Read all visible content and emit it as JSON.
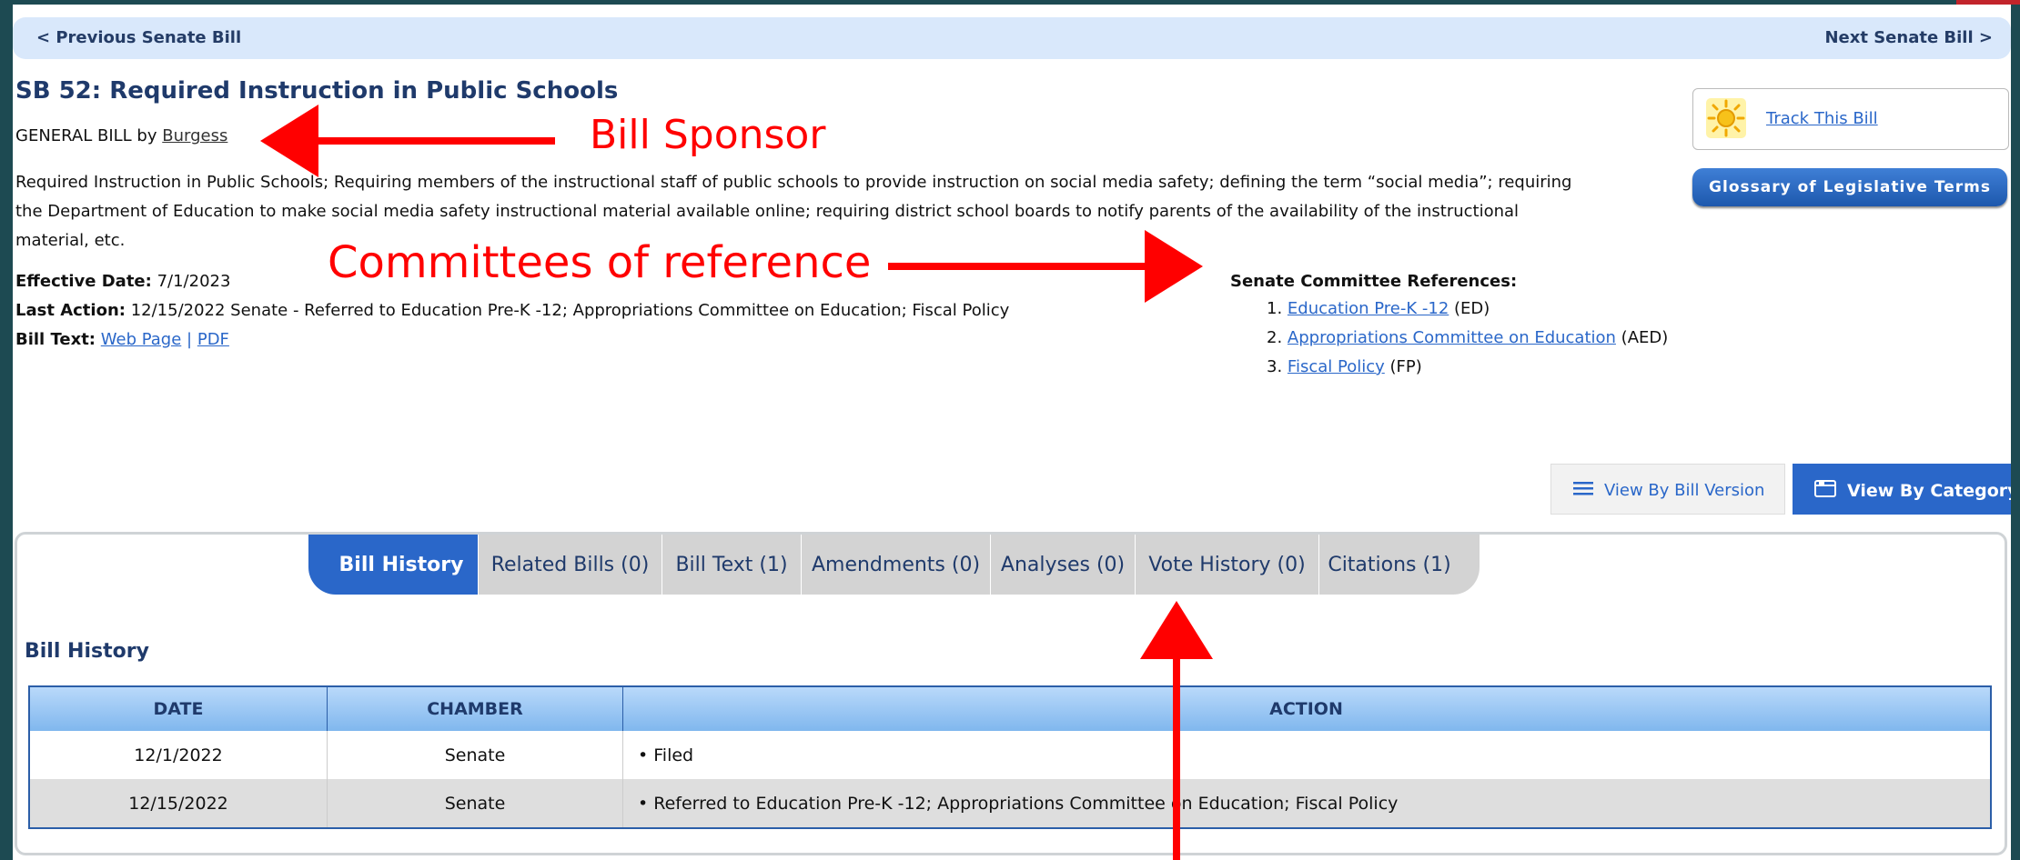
{
  "nav": {
    "prev_label": "< Previous Senate Bill",
    "next_label": "Next Senate Bill >"
  },
  "bill": {
    "title": "SB 52: Required Instruction in Public Schools",
    "type_prefix": "GENERAL BILL by",
    "sponsor": "Burgess",
    "description": "Required Instruction in Public Schools; Requiring members of the instructional staff of public schools to provide instruction on social media safety; defining the term “social media”; requiring the Department of Education to make social media safety instructional material available online; requiring district school boards to notify parents of the availability of the instructional material, etc.",
    "effective_label": "Effective Date:",
    "effective_date": "7/1/2023",
    "last_action_label": "Last Action:",
    "last_action": "12/15/2022 Senate - Referred to Education Pre-K -12; Appropriations Committee on Education; Fiscal Policy",
    "bill_text_label": "Bill Text:",
    "web_page_link": "Web Page",
    "separator": "|",
    "pdf_link": "PDF"
  },
  "committees": {
    "heading": "Senate Committee References:",
    "items": [
      {
        "num": "1.",
        "name": "Education Pre-K -12",
        "abbr": "(ED)"
      },
      {
        "num": "2.",
        "name": "Appropriations Committee on Education",
        "abbr": "(AED)"
      },
      {
        "num": "3.",
        "name": "Fiscal Policy",
        "abbr": "(FP)"
      }
    ]
  },
  "side": {
    "track_label": "Track This Bill",
    "glossary_label": "Glossary of Legislative Terms"
  },
  "view_buttons": {
    "by_version": "View By Bill Version",
    "by_category": "View By Category"
  },
  "tabs": [
    {
      "label": "Bill History",
      "active": true
    },
    {
      "label": "Related Bills (0)"
    },
    {
      "label": "Bill Text (1)"
    },
    {
      "label": "Amendments (0)"
    },
    {
      "label": "Analyses (0)"
    },
    {
      "label": "Vote History (0)"
    },
    {
      "label": "Citations (1)"
    }
  ],
  "history": {
    "title": "Bill History",
    "columns": [
      "DATE",
      "CHAMBER",
      "ACTION"
    ],
    "rows": [
      {
        "date": "12/1/2022",
        "chamber": "Senate",
        "action": "• Filed"
      },
      {
        "date": "12/15/2022",
        "chamber": "Senate",
        "action": "• Referred to Education Pre-K -12; Appropriations Committee on Education; Fiscal Policy"
      }
    ]
  },
  "annotations": {
    "sponsor": "Bill Sponsor",
    "committees": "Committees of reference"
  },
  "colors": {
    "frame": "#1d4a52",
    "accent_blue": "#2a67c9",
    "title_navy": "#1f3a6b",
    "annotation_red": "#ff0000"
  }
}
